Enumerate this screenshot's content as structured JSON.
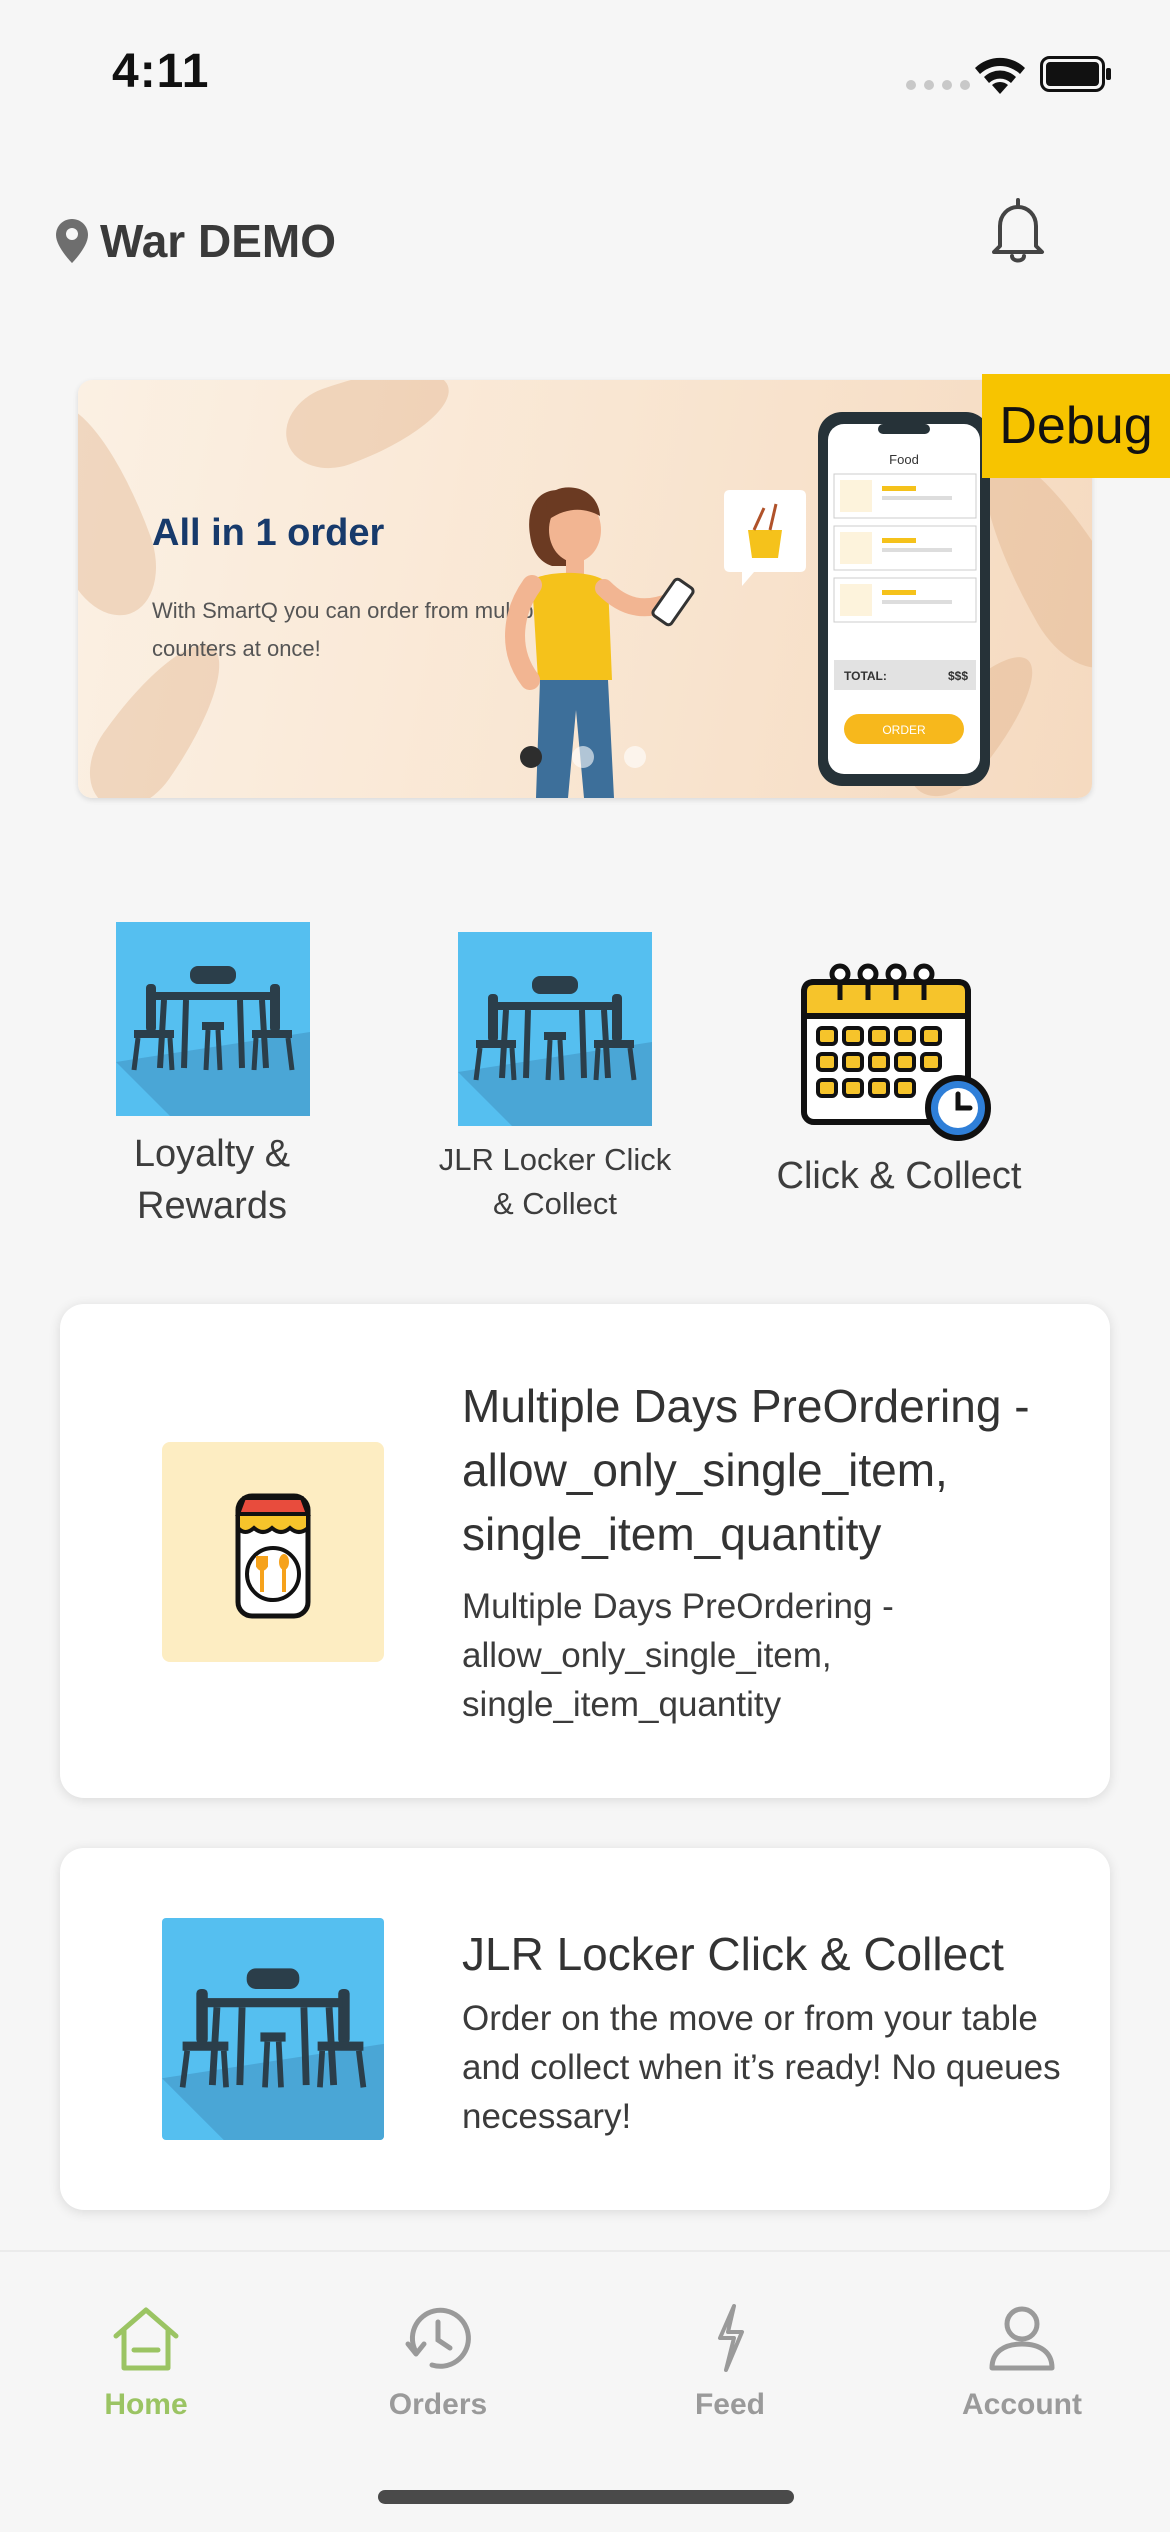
{
  "status_bar": {
    "time": "4:11"
  },
  "header": {
    "location": "War DEMO",
    "location_icon": "map-pin-icon",
    "notification_icon": "bell-icon"
  },
  "banner": {
    "title": "All in 1 order",
    "subtitle": "With SmartQ you can order from multiple counters at once!",
    "phone_header": "Food",
    "phone_total_label": "TOTAL:",
    "phone_total_value": "$$$",
    "phone_order_button": "ORDER",
    "dots_count": 3,
    "active_dot": 0
  },
  "debug_badge": "Debug",
  "shortcuts": [
    {
      "label_line1": "Loyalty &",
      "label_line2": "Rewards",
      "icon": "dining-table-icon"
    },
    {
      "label_line1": "JLR Locker Click",
      "label_line2": "& Collect",
      "icon": "dining-table-icon"
    },
    {
      "label_line1": "Click & Collect",
      "label_line2": "",
      "icon": "calendar-clock-icon"
    }
  ],
  "cards": [
    {
      "title_lines": [
        "Multiple Days PreOrdering -",
        "allow_only_single_item,",
        "single_item_quantity"
      ],
      "desc_lines": [
        "Multiple Days PreOrdering -",
        "allow_only_single_item,",
        "single_item_quantity"
      ],
      "icon": "restaurant-menu-icon"
    },
    {
      "title_lines": [
        "JLR Locker Click & Collect"
      ],
      "desc_lines": [
        "Order on the move or from your table",
        "and collect when it’s ready! No queues",
        "necessary!"
      ],
      "icon": "dining-table-icon"
    }
  ],
  "tabbar": {
    "items": [
      {
        "label": "Home",
        "icon": "home-icon",
        "active": true
      },
      {
        "label": "Orders",
        "icon": "clock-history-icon",
        "active": false
      },
      {
        "label": "Feed",
        "icon": "lightning-icon",
        "active": false
      },
      {
        "label": "Account",
        "icon": "user-icon",
        "active": false
      }
    ]
  },
  "colors": {
    "accent": "#9bc463",
    "tile_blue": "#55bff0",
    "debug_yellow": "#f7c400",
    "banner_title": "#173a6b"
  }
}
